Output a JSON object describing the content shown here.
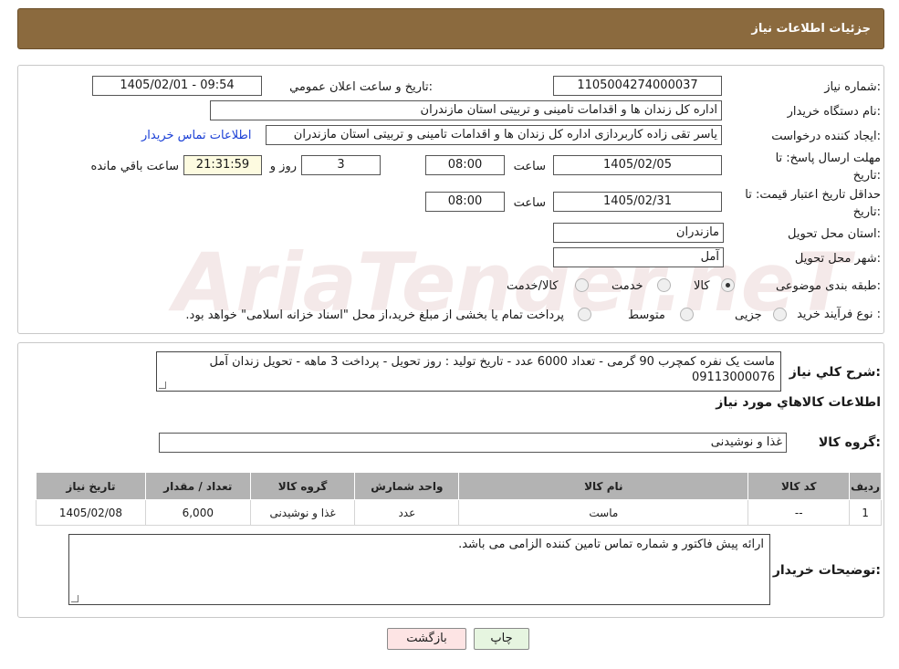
{
  "header": {
    "title": "جزئیات اطلاعات نیاز"
  },
  "watermark": {
    "text": "AriaTender.neT"
  },
  "form": {
    "need_number": {
      "label": "شماره نیاز:",
      "value": "1105004274000037"
    },
    "announce_datetime": {
      "label": "تاریخ و ساعت اعلان عمومي:",
      "value": "1405/02/01 - 09:54"
    },
    "buyer_org": {
      "label": "نام دستگاه خریدار:",
      "value": "اداره کل زندان ها و اقدامات تامینی و تربیتی استان مازندران"
    },
    "requester": {
      "label": "ایجاد کننده درخواست:",
      "value": "یاسر تقی زاده کاربردازی اداره کل زندان ها و اقدامات تامینی و تربیتی استان مازندران",
      "contact_link": "اطلاعات تماس خریدار"
    },
    "deadline": {
      "label_line1": "مهلت ارسال پاسخ: تا",
      "label_line2": "تاریخ:",
      "date": "1405/02/05",
      "time_label": "ساعت",
      "time": "08:00",
      "days": "3",
      "days_label": "روز و",
      "remaining": "21:31:59",
      "remaining_label": "ساعت باقي مانده"
    },
    "price_validity": {
      "label_line1": "حداقل تاریخ اعتبار قیمت: تا",
      "label_line2": "تاریخ:",
      "date": "1405/02/31",
      "time_label": "ساعت",
      "time": "08:00"
    },
    "province": {
      "label": "استان محل تحویل:",
      "value": "مازندران"
    },
    "city": {
      "label": "شهر محل تحویل:",
      "value": "آمل"
    },
    "category": {
      "label": "طبقه بندی موضوعی:",
      "options": [
        "کالا",
        "خدمت",
        "کالا/خدمت"
      ],
      "selected": "کالا"
    },
    "process": {
      "label": "نوع فرآیند خرید :",
      "options": [
        "جزیی",
        "متوسط"
      ],
      "note": "پرداخت تمام یا بخشی از مبلغ خرید،از محل \"اسناد خزانه اسلامی\" خواهد بود."
    }
  },
  "description": {
    "label": "شرح كلي نياز:",
    "text": "ماست یک نفره کمچرب 90 گرمی - تعداد 6000 عدد -  تاریخ تولید : روز تحویل - پرداخت 3 ماهه - تحویل زندان آمل  09113000076"
  },
  "goods_section": {
    "title": "اطلاعات كالاهاي مورد نياز",
    "group_label": "گروه كالا:",
    "group_value": "غذا و نوشیدنی"
  },
  "table": {
    "headers": [
      "رديف",
      "كد كالا",
      "نام كالا",
      "واحد شمارش",
      "گروه كالا",
      "تعداد / مقدار",
      "تاريخ نياز"
    ],
    "rows": [
      [
        "1",
        "--",
        "ماست",
        "عدد",
        "غذا و نوشیدنی",
        "6,000",
        "1405/02/08"
      ]
    ]
  },
  "buyer_notes": {
    "label": "توضیحات خریدار:",
    "text": "ارائه پیش فاکتور و شماره تماس تامین کننده الزامی می باشد."
  },
  "buttons": {
    "print": "چاپ",
    "back": "بازگشت"
  }
}
